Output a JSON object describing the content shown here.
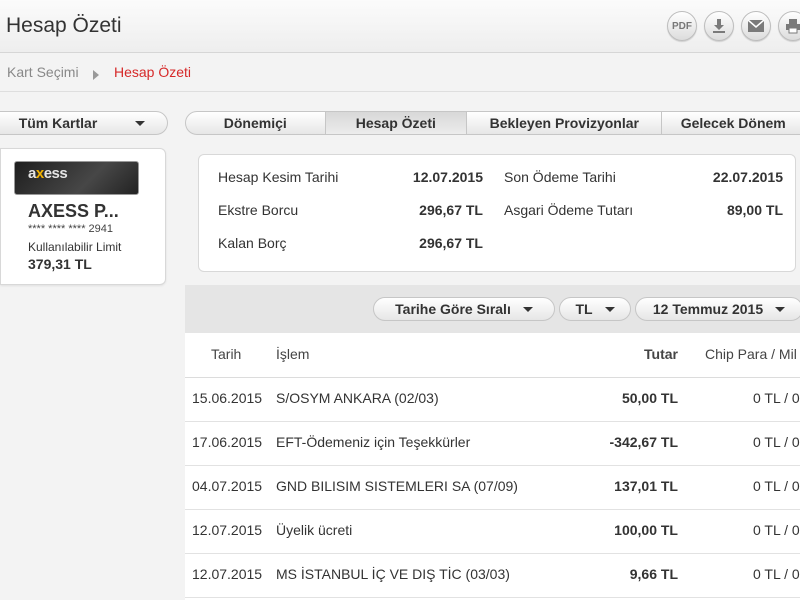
{
  "header": {
    "title": "Hesap Özeti",
    "icons": [
      {
        "name": "pdf-icon",
        "label": "PDF"
      },
      {
        "name": "download-icon",
        "label": ""
      },
      {
        "name": "mail-icon",
        "label": ""
      },
      {
        "name": "print-icon",
        "label": ""
      }
    ]
  },
  "breadcrumb": {
    "items": [
      "Kart Seçimi",
      "Hesap Özeti"
    ],
    "active_color": "#d62929"
  },
  "card_selector": {
    "label": "Tüm Kartlar"
  },
  "tabs": [
    {
      "label": "Dönemiçi",
      "active": false
    },
    {
      "label": "Hesap Özeti",
      "active": true
    },
    {
      "label": "Bekleyen Provizyonlar",
      "active": false
    },
    {
      "label": "Gelecek Dönem",
      "active": false
    }
  ],
  "card": {
    "logo_text": "axess",
    "name": "AXESS P...",
    "number": "**** **** **** 2941",
    "limit_label": "Kullanılabilir Limit",
    "limit_value": "379,31 TL"
  },
  "summary": {
    "statement_date_label": "Hesap Kesim Tarihi",
    "statement_date": "12.07.2015",
    "due_date_label": "Son Ödeme Tarihi",
    "due_date": "22.07.2015",
    "statement_debt_label": "Ekstre Borcu",
    "statement_debt": "296,67 TL",
    "min_payment_label": "Asgari Ödeme Tutarı",
    "min_payment": "89,00 TL",
    "remaining_debt_label": "Kalan Borç",
    "remaining_debt": "296,67 TL"
  },
  "filters": {
    "sort_label": "Tarihe Göre Sıralı",
    "currency_label": "TL",
    "period_label": "12 Temmuz 2015"
  },
  "table": {
    "headers": [
      "Tarih",
      "İşlem",
      "Tutar",
      "Chip Para / Mil"
    ],
    "rows": [
      {
        "date": "15.06.2015",
        "desc": "S/OSYM ANKARA (02/03)",
        "amount": "50,00 TL",
        "chip": "0 TL / 0"
      },
      {
        "date": "17.06.2015",
        "desc": "EFT-Ödemeniz için Teşekkürler",
        "amount": "-342,67 TL",
        "chip": "0 TL / 0"
      },
      {
        "date": "04.07.2015",
        "desc": "GND BILISIM SISTEMLERI SA (07/09)",
        "amount": "137,01 TL",
        "chip": "0 TL / 0"
      },
      {
        "date": "12.07.2015",
        "desc": "Üyelik ücreti",
        "amount": "100,00 TL",
        "chip": "0 TL / 0"
      },
      {
        "date": "12.07.2015",
        "desc": "MS İSTANBUL İÇ VE DIŞ TİC (03/03)",
        "amount": "9,66 TL",
        "chip": "0 TL / 0"
      }
    ]
  }
}
